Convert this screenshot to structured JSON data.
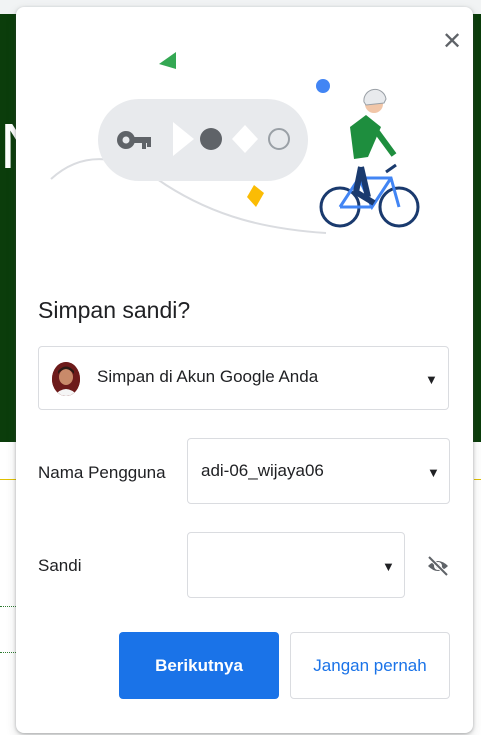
{
  "background": {
    "partial_letter": "N"
  },
  "dialog": {
    "title": "Simpan sandi?",
    "account": {
      "label": "Simpan di Akun Google Anda",
      "caret": "▼"
    },
    "username": {
      "label": "Nama Pengguna",
      "value": "adi-06_wijaya06",
      "caret": "▼"
    },
    "password": {
      "label": "Sandi",
      "value": "",
      "caret": "▼"
    },
    "buttons": {
      "primary": "Berikutnya",
      "secondary": "Jangan pernah"
    },
    "close_glyph": "✕"
  },
  "icons": {
    "close": "close-icon",
    "dropdown": "chevron-down-icon",
    "visibility": "visibility-off-icon",
    "key": "key-icon"
  },
  "colors": {
    "primary": "#1a73e8",
    "background_green": "#0b3d0b",
    "text": "#202124",
    "border": "#dadce0"
  }
}
